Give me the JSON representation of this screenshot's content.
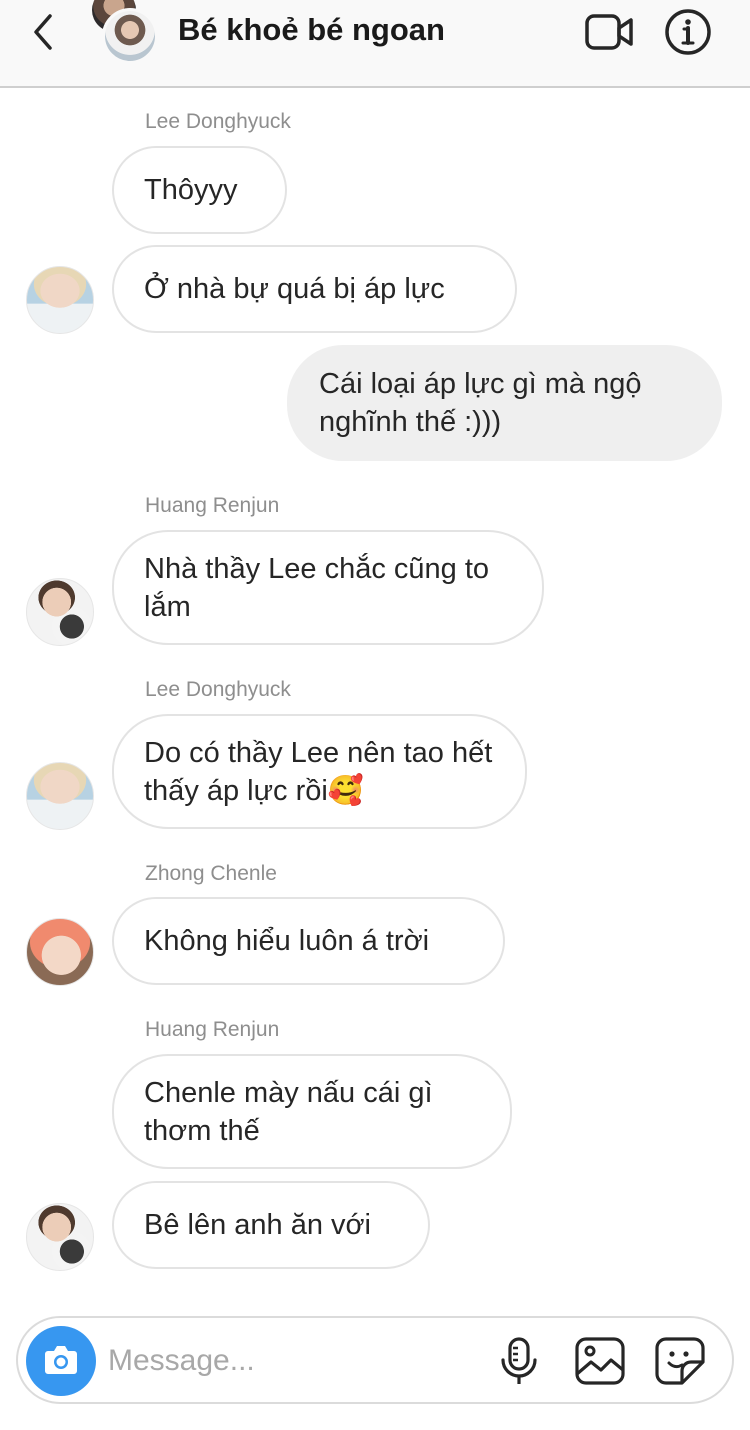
{
  "header": {
    "title": "Bé khoẻ bé ngoan",
    "back_icon": "chevron-left-icon",
    "video_icon": "video-call-icon",
    "info_icon": "info-icon"
  },
  "messages": [
    {
      "sender": "Lee Donghyuck",
      "text": "Thôyyy",
      "avatar": "lee-donghyuck",
      "own": false
    },
    {
      "sender": "",
      "text": "Ở nhà bự quá bị áp lực",
      "avatar": "lee-donghyuck",
      "own": false
    },
    {
      "sender": "",
      "text": "Cái loại áp lực gì mà ngộ nghĩnh thế :)))",
      "own": true
    },
    {
      "sender": "Huang Renjun",
      "text": "Nhà thầy Lee chắc cũng to lắm",
      "avatar": "huang-renjun",
      "own": false
    },
    {
      "sender": "Lee Donghyuck",
      "text": "Do có thầy Lee nên tao hết thấy áp lực rồi🥰",
      "avatar": "lee-donghyuck",
      "own": false
    },
    {
      "sender": "Zhong Chenle",
      "text": "Không hiểu luôn á trời",
      "avatar": "zhong-chenle",
      "own": false
    },
    {
      "sender": "Huang Renjun",
      "text": "Chenle mày nấu cái gì thơm thế",
      "own": false
    },
    {
      "sender": "",
      "text": "Bê lên anh ăn với",
      "avatar": "huang-renjun",
      "own": false
    }
  ],
  "composer": {
    "placeholder": "Message...",
    "camera_icon": "camera-icon",
    "mic_icon": "microphone-icon",
    "gallery_icon": "image-gallery-icon",
    "sticker_icon": "sticker-icon",
    "accent_color": "#3797f0"
  }
}
